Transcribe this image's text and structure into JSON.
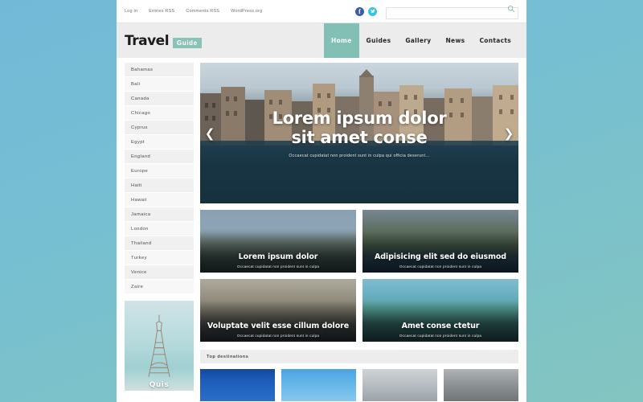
{
  "topbar": {
    "links": [
      {
        "label": "Log in",
        "underline": false
      },
      {
        "label": "Entries RSS",
        "underline": true
      },
      {
        "label": "Comments RSS",
        "underline": true
      },
      {
        "label": "WordPress.org",
        "underline": false
      }
    ],
    "social": [
      {
        "name": "facebook-icon",
        "glyph": "f",
        "color": "#3b5ca8"
      },
      {
        "name": "twitter-icon",
        "glyph": "t",
        "color": "#36c5e0"
      }
    ],
    "search": {
      "value": "",
      "placeholder": "",
      "icon": "search-icon"
    }
  },
  "header": {
    "logo": {
      "primary": "Travel",
      "badge": "Guide",
      "badge_color": "#8bc2b8"
    },
    "nav": [
      {
        "label": "Home",
        "active": true
      },
      {
        "label": "Guides",
        "active": false
      },
      {
        "label": "Gallery",
        "active": false
      },
      {
        "label": "News",
        "active": false
      },
      {
        "label": "Contacts",
        "active": false
      }
    ],
    "accent_color": "#82bfb4"
  },
  "sidebar": {
    "destinations": [
      "Bahamas",
      "Bali",
      "Canada",
      "Chicago",
      "Cyprus",
      "Egypt",
      "England",
      "Europe",
      "Haiti",
      "Hawaii",
      "Jamaica",
      "London",
      "Thailand",
      "Turkey",
      "Venice",
      "Zaire"
    ],
    "promo": {
      "label": "Quis",
      "image": "eiffel-tower"
    }
  },
  "hero": {
    "title_line1": "Lorem ipsum dolor",
    "title_line2": "sit amet conse",
    "subtitle": "Occaecat cupidatat non proident sunt in culpa qui officia deserunt...",
    "prev_icon": "chevron-left-icon",
    "next_icon": "chevron-right-icon"
  },
  "cards": [
    {
      "title": "Lorem ipsum dolor",
      "subtitle": "Occaecat cupidatat non proident sunt in culpa",
      "art": "art-chateau"
    },
    {
      "title": "Adipisicing elit sed do eiusmod",
      "subtitle": "Occaecat cupidatat non proident sunt in culpa",
      "art": "art-coast"
    },
    {
      "title": "Voluptate velit esse cillum dolore",
      "subtitle": "Occaecat cupidatat non proident sunt in culpa",
      "art": "art-city"
    },
    {
      "title": "Amet conse ctetur",
      "subtitle": "Occaecat cupidatat non proident sunt in culpa",
      "art": "art-beach"
    }
  ],
  "top_destinations": {
    "heading": "Top destinations",
    "thumbs": [
      {
        "art": "t1"
      },
      {
        "art": "t2"
      },
      {
        "art": "t3"
      },
      {
        "art": "t4"
      }
    ]
  }
}
